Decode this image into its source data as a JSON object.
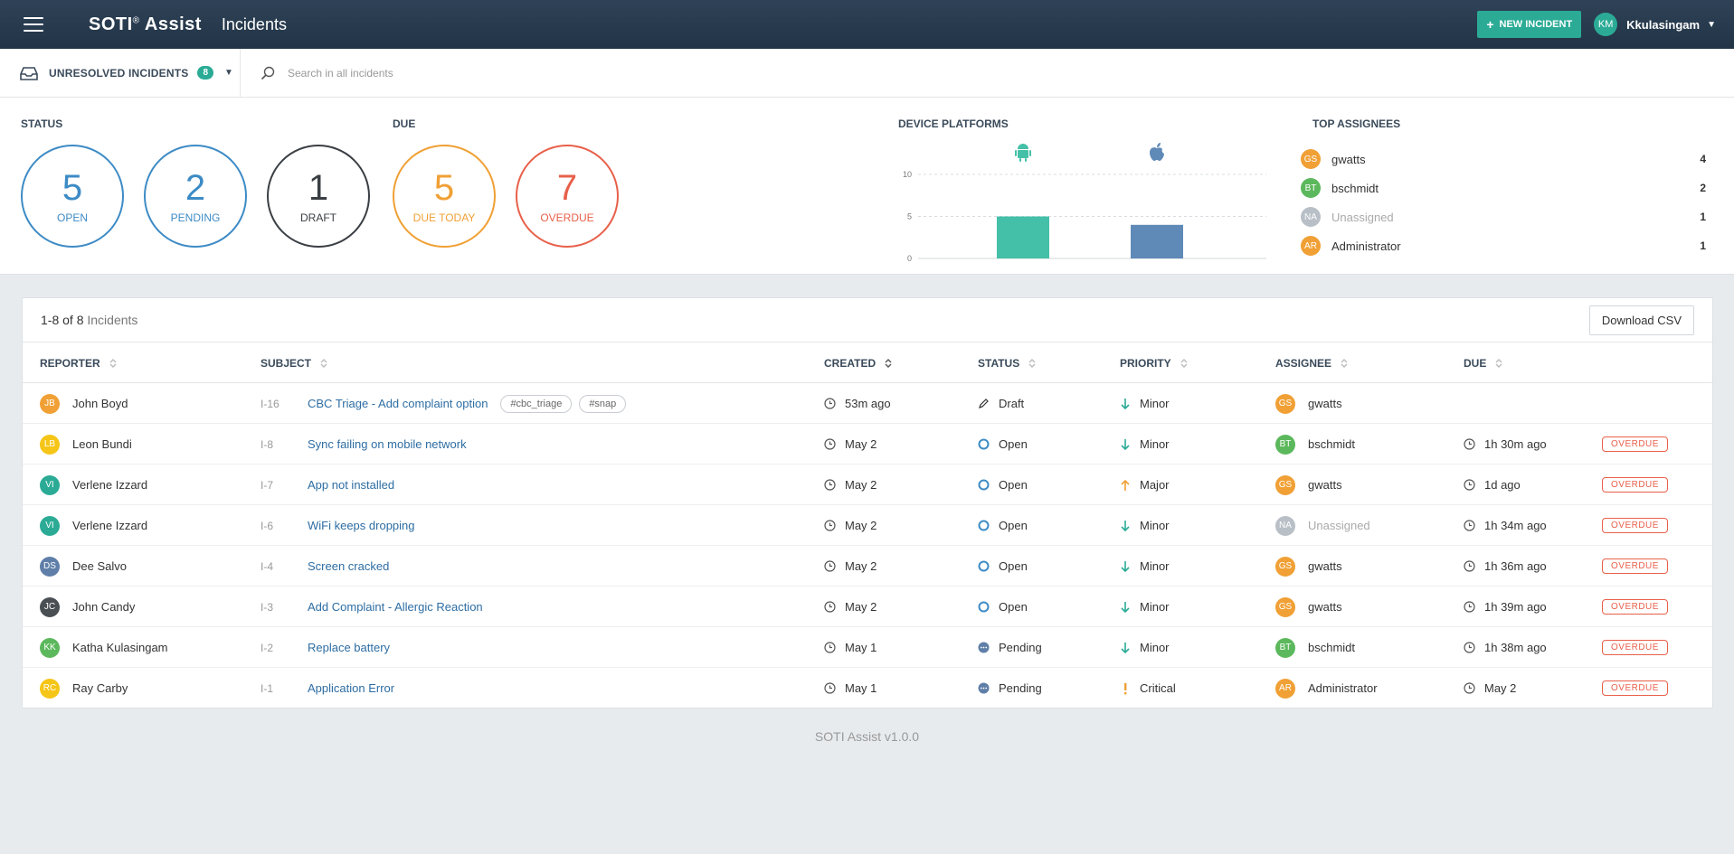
{
  "header": {
    "brand": "SOTI",
    "brand_mark": "®",
    "brand_suffix": "Assist",
    "title": "Incidents",
    "new_incident_plus": "+",
    "new_incident_label": "NEW INCIDENT",
    "user_initials": "KM",
    "user_name": "Kkulasingam",
    "accent": "#2bab96"
  },
  "filter": {
    "label": "UNRESOLVED INCIDENTS",
    "count": "8",
    "search_placeholder": "Search in all incidents"
  },
  "stats": {
    "status_label": "STATUS",
    "due_label": "DUE",
    "platforms_label": "DEVICE PLATFORMS",
    "assignees_label": "TOP ASSIGNEES",
    "circles": [
      {
        "value": "5",
        "label": "OPEN",
        "color": "#3d8bc5"
      },
      {
        "value": "2",
        "label": "PENDING",
        "color": "#3d8bc5"
      },
      {
        "value": "1",
        "label": "DRAFT",
        "color": "#3a3f44"
      },
      {
        "value": "5",
        "label": "DUE TODAY",
        "color": "#f0a035"
      },
      {
        "value": "7",
        "label": "OVERDUE",
        "color": "#e8604a"
      }
    ],
    "top_assignees": [
      {
        "initials": "GS",
        "name": "gwatts",
        "count": "4",
        "color": "#f0a035"
      },
      {
        "initials": "BT",
        "name": "bschmidt",
        "count": "2",
        "color": "#5cb85c"
      },
      {
        "initials": "NA",
        "name": "Unassigned",
        "count": "1",
        "color": "#b8bfc6"
      },
      {
        "initials": "AR",
        "name": "Administrator",
        "count": "1",
        "color": "#f0a035"
      }
    ]
  },
  "chart_data": {
    "type": "bar",
    "categories": [
      "android-icon",
      "apple-icon"
    ],
    "values": [
      5,
      4
    ],
    "colors": [
      "#45c0a8",
      "#5f8ab8"
    ],
    "ylim": [
      0,
      10
    ],
    "yticks": [
      "0",
      "5",
      "10"
    ],
    "grid": true
  },
  "table": {
    "count_range": "1-8 of 8",
    "count_suffix": "Incidents",
    "download_label": "Download CSV",
    "columns": [
      "REPORTER",
      "SUBJECT",
      "CREATED",
      "STATUS",
      "PRIORITY",
      "ASSIGNEE",
      "DUE"
    ],
    "rows": [
      {
        "rep_initials": "JB",
        "rep_color": "#f0a035",
        "reporter": "John Boyd",
        "ref": "I-16",
        "subject": "CBC Triage - Add complaint option",
        "tags": [
          "#cbc_triage",
          "#snap"
        ],
        "created": "53m ago",
        "status": "Draft",
        "priority": "Minor",
        "asg_initials": "GS",
        "asg_color": "#f0a035",
        "assignee": "gwatts",
        "due": "",
        "overdue": ""
      },
      {
        "rep_initials": "LB",
        "rep_color": "#f5c518",
        "reporter": "Leon Bundi",
        "ref": "I-8",
        "subject": "Sync failing on mobile network",
        "tags": [],
        "created": "May 2",
        "status": "Open",
        "priority": "Minor",
        "asg_initials": "BT",
        "asg_color": "#5cb85c",
        "assignee": "bschmidt",
        "due": "1h 30m ago",
        "overdue": "OVERDUE"
      },
      {
        "rep_initials": "VI",
        "rep_color": "#2bab96",
        "reporter": "Verlene Izzard",
        "ref": "I-7",
        "subject": "App not installed",
        "tags": [],
        "created": "May 2",
        "status": "Open",
        "priority": "Major",
        "asg_initials": "GS",
        "asg_color": "#f0a035",
        "assignee": "gwatts",
        "due": "1d ago",
        "overdue": "OVERDUE"
      },
      {
        "rep_initials": "VI",
        "rep_color": "#2bab96",
        "reporter": "Verlene Izzard",
        "ref": "I-6",
        "subject": "WiFi keeps dropping",
        "tags": [],
        "created": "May 2",
        "status": "Open",
        "priority": "Minor",
        "asg_initials": "NA",
        "asg_color": "#b8bfc6",
        "assignee": "Unassigned",
        "due": "1h 34m ago",
        "overdue": "OVERDUE"
      },
      {
        "rep_initials": "DS",
        "rep_color": "#5f7fa8",
        "reporter": "Dee Salvo",
        "ref": "I-4",
        "subject": "Screen cracked",
        "tags": [],
        "created": "May 2",
        "status": "Open",
        "priority": "Minor",
        "asg_initials": "GS",
        "asg_color": "#f0a035",
        "assignee": "gwatts",
        "due": "1h 36m ago",
        "overdue": "OVERDUE"
      },
      {
        "rep_initials": "JC",
        "rep_color": "#4a4f54",
        "reporter": "John Candy",
        "ref": "I-3",
        "subject": "Add Complaint - Allergic Reaction",
        "tags": [],
        "created": "May 2",
        "status": "Open",
        "priority": "Minor",
        "asg_initials": "GS",
        "asg_color": "#f0a035",
        "assignee": "gwatts",
        "due": "1h 39m ago",
        "overdue": "OVERDUE"
      },
      {
        "rep_initials": "KK",
        "rep_color": "#5cb85c",
        "reporter": "Katha Kulasingam",
        "ref": "I-2",
        "subject": "Replace battery",
        "tags": [],
        "created": "May 1",
        "status": "Pending",
        "priority": "Minor",
        "asg_initials": "BT",
        "asg_color": "#5cb85c",
        "assignee": "bschmidt",
        "due": "1h 38m ago",
        "overdue": "OVERDUE"
      },
      {
        "rep_initials": "RC",
        "rep_color": "#f5c518",
        "reporter": "Ray Carby",
        "ref": "I-1",
        "subject": "Application Error",
        "tags": [],
        "created": "May 1",
        "status": "Pending",
        "priority": "Critical",
        "asg_initials": "AR",
        "asg_color": "#f0a035",
        "assignee": "Administrator",
        "due": "May 2",
        "overdue": "OVERDUE"
      }
    ]
  },
  "footer": {
    "version": "SOTI Assist v1.0.0"
  }
}
